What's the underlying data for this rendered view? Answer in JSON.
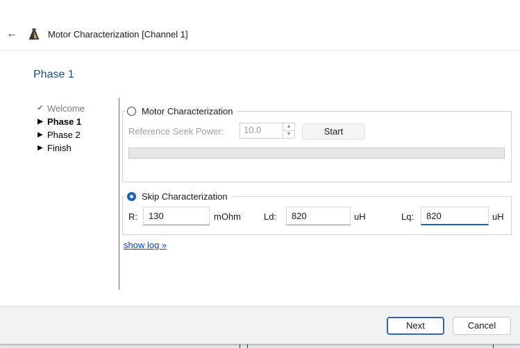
{
  "window": {
    "title": "Motor Characterization [Channel 1]"
  },
  "page": {
    "title": "Phase 1"
  },
  "steps": [
    {
      "label": "Welcome",
      "state": "done"
    },
    {
      "label": "Phase 1",
      "state": "current"
    },
    {
      "label": "Phase 2",
      "state": "pending"
    },
    {
      "label": "Finish",
      "state": "pending"
    }
  ],
  "motor_char": {
    "label": "Motor Characterization",
    "selected": false,
    "seek_power_label": "Reference Seek Power:",
    "seek_power_value": "10.0",
    "start_label": "Start",
    "progress": 0
  },
  "skip_char": {
    "label": "Skip Characterization",
    "selected": true,
    "r_label": "R:",
    "r_value": "130",
    "r_unit": "mOhm",
    "ld_label": "Ld:",
    "ld_value": "820",
    "ld_unit": "uH",
    "lq_label": "Lq:",
    "lq_value": "820",
    "lq_unit": "uH"
  },
  "show_log": "show log »",
  "buttons": {
    "next": "Next",
    "cancel": "Cancel"
  },
  "colors": {
    "accent": "#1c5fb8",
    "title": "#1f4e8f",
    "link": "#0b44c9"
  }
}
